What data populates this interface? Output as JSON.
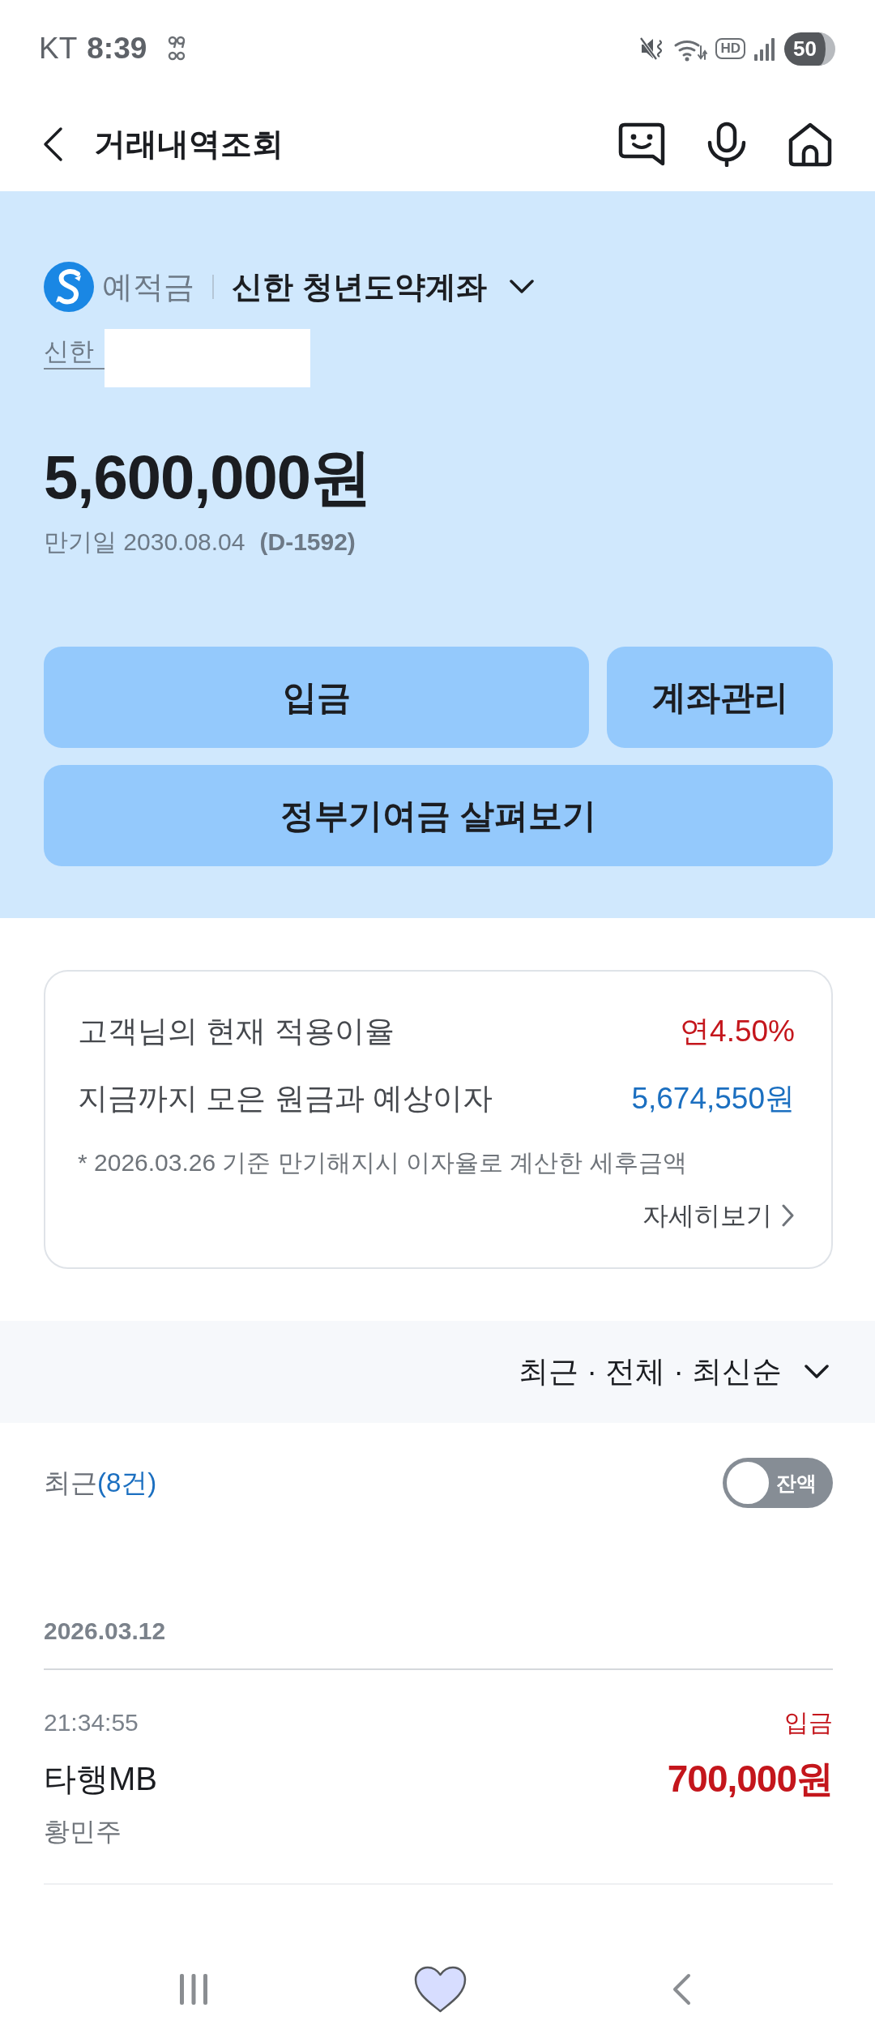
{
  "status_bar": {
    "carrier": "KT",
    "time": "8:39",
    "hd_label": "HD",
    "battery": "50"
  },
  "header": {
    "title": "거래내역조회"
  },
  "account": {
    "category": "예적금",
    "name": "신한 청년도약계좌",
    "bank": "신한",
    "balance": "5,600,000원",
    "maturity": "만기일 2030.08.04",
    "d_day": "(D-1592)"
  },
  "actions": [
    {
      "label": "입금"
    },
    {
      "label": "계좌관리"
    },
    {
      "label": "정부기여금 살펴보기"
    }
  ],
  "interest_card": {
    "rows": [
      {
        "label": "고객님의 현재 적용이율",
        "value": "연4.50%",
        "color": "#c4161c"
      },
      {
        "label": "지금까지 모은 원금과 예상이자",
        "value": "5,674,550원",
        "color": "#1b6fc0"
      }
    ],
    "note": "* 2026.03.26 기준 만기해지시 이자율로 계산한 세후금액",
    "more_link": "자세히보기"
  },
  "filter": {
    "label": "최근 · 전체 · 최신순"
  },
  "list_header": {
    "label": "최근",
    "count": "(8건)",
    "balance_toggle": {
      "label": "잔액",
      "on": false
    }
  },
  "transactions": [
    {
      "date": "2026.03.12",
      "items": [
        {
          "time": "21:34:55",
          "type": "입금",
          "kind": "deposit",
          "description": "타행MB",
          "amount": "700,000원",
          "counterparty": "황민주"
        }
      ]
    }
  ]
}
